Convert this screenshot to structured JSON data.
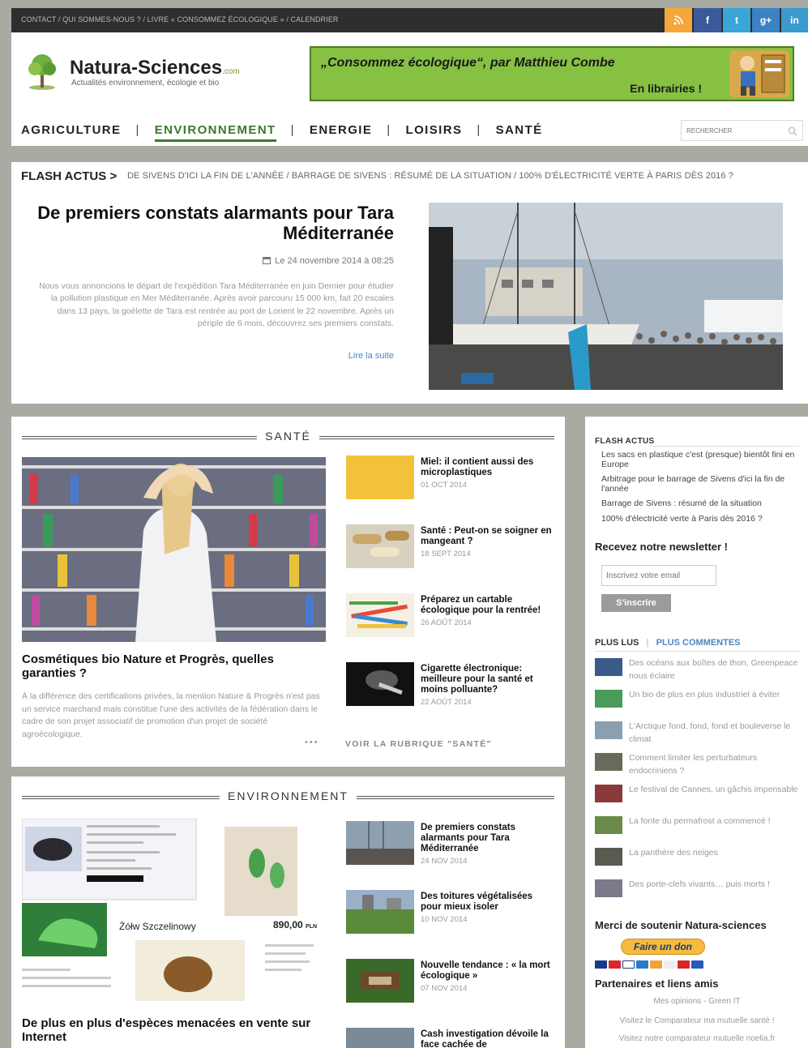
{
  "top_links": "CONTACT / QUI SOMMES-NOUS ? / LIVRE « CONSOMMEZ ÉCOLOGIQUE » / CALENDRIER",
  "social": [
    "rss-icon",
    "facebook-icon",
    "twitter-icon",
    "googleplus-icon",
    "linkedin-icon"
  ],
  "logo": {
    "name": "Natura-Sciences",
    "suffix": ".com",
    "tagline": "Actualités environnement, écologie et bio"
  },
  "banner": {
    "line1": "„Consommez écologique“, par Matthieu Combe",
    "line2": "En librairies !"
  },
  "nav": {
    "items": [
      "AGRICULTURE",
      "ENVIRONNEMENT",
      "ENERGIE",
      "LOISIRS",
      "SANTÉ"
    ],
    "active": "ENVIRONNEMENT",
    "search_placeholder": "RECHERCHER"
  },
  "flash": {
    "label": "FLASH ACTUS >",
    "text": "DE SIVENS D'ICI LA FIN DE L'ANNÉE  /  BARRAGE DE SIVENS : RÉSUMÉ DE LA SITUATION  /  100% D'ÉLECTRICITÉ VERTE À PARIS DÈS 2016 ?"
  },
  "featured": {
    "title": "De premiers constats alarmants pour Tara Méditerranée",
    "date": "Le 24 novembre 2014 à 08:25",
    "text": "Nous vous annoncions le départ de l'expédition Tara Méditerranée en juin Dernier pour étudier la pollution plastique en Mer Méditerranée. Après avoir parcouru 15 000 km, fait 20 escales dans 13 pays, la goélette de Tara est rentrée au port de Lorient le 22 novembre. Après un périple de 6 mois, découvrez ses premiers constats.",
    "more": "Lire la suite"
  },
  "sante": {
    "title": "SANTÉ",
    "main_title": "Cosmétiques bio Nature et Progrès, quelles garanties ?",
    "main_text": "À la différence des certifications privées, la mention Nature & Progrès n'est pas un service marchand mais constitue l'une des activités de la fédération dans le cadre de son projet associatif de promotion d'un projet de société agroécologique.",
    "dots": "•••",
    "items": [
      {
        "title": "Miel: il contient aussi des microplastiques",
        "date": "01 OCT 2014"
      },
      {
        "title": "Santé : Peut-on se soigner en mangeant ?",
        "date": "18 SEPT 2014"
      },
      {
        "title": "Préparez un cartable écologique pour la rentrée!",
        "date": "26 AOÛT 2014"
      },
      {
        "title": "Cigarette électronique: meilleure pour la santé et moins polluante?",
        "date": "22 AOÛT 2014"
      }
    ],
    "voir": "VOIR LA RUBRIQUE \"SANTÉ\""
  },
  "envir": {
    "title": "ENVIRONNEMENT",
    "main_title": "De plus en plus d'espèces menacées en vente sur Internet",
    "collage_caption": "Żółw Szczelinowy",
    "collage_price": "890,00",
    "collage_currency": "PLN",
    "items": [
      {
        "title": "De premiers constats alarmants pour Tara Méditerranée",
        "date": "24 NOV 2014"
      },
      {
        "title": "Des toitures végétalisées pour mieux isoler",
        "date": "10 NOV 2014"
      },
      {
        "title": "Nouvelle tendance : « la mort écologique »",
        "date": "07 NOV 2014"
      },
      {
        "title": "Cash investigation dévoile la face cachée de",
        "date": ""
      }
    ]
  },
  "sidebar": {
    "flash_title": "FLASH ACTUS",
    "flash_items": [
      "Les sacs en plastique c'est (presque) bientôt fini en Europe",
      "Arbitrage pour le barrage de Sivens d'ici la fin de l'année",
      "Barrage de Sivens : résumé de la situation",
      "100% d'électricité verte à Paris dès 2016 ?"
    ],
    "newsletter_title": "Recevez notre newsletter !",
    "email_placeholder": "Inscrivez votre email",
    "subscribe": "S'inscrire",
    "tab1": "PLUS LUS",
    "tab2": "PLUS COMMENTES",
    "popular": [
      "Des océans aux boîtes de thon, Greenpeace nous éclaire",
      "Un bio de plus en plus industriel à éviter",
      "L'Arctique fond, fond, fond et bouleverse le climat",
      "Comment limiter les perturbateurs endocriniens ?",
      "Le festival de Cannes, un gâchis impensable",
      "La fonte du permafrost a commencé !",
      "La panthère des neiges",
      "Des porte-clefs vivants… puis morts !"
    ],
    "support_title": "Merci de soutenir Natura-sciences",
    "donate": "Faire un don",
    "partners_title": "Partenaires et liens amis",
    "partner_links": [
      "Mes opinions - Green IT",
      "Visitez le Comparateur ma mutuelle santé !",
      "Visitez notre comparateur mutuelle noelia.fr"
    ]
  },
  "colors": {
    "accent_green": "#3a7a2a",
    "banner_green": "#86c143",
    "topbar": "#2e2e2e",
    "link_blue": "#4a86c0"
  }
}
